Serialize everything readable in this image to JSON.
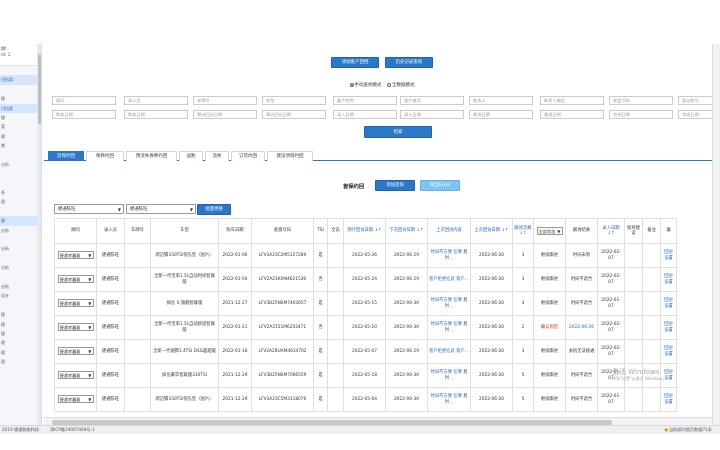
{
  "sidebar": {
    "head_line1": "期!",
    "head_line2": "nt: 1",
    "items": [
      {
        "label": "",
        "active": false
      },
      {
        "label": "归挡案",
        "active": true
      },
      {
        "label": "",
        "active": false
      },
      {
        "label": "理",
        "active": false
      },
      {
        "label": "归挡案",
        "active": true
      },
      {
        "label": "理",
        "active": false
      },
      {
        "label": "案",
        "active": false
      },
      {
        "label": "理",
        "active": false
      },
      {
        "label": "期",
        "active": false
      },
      {
        "label": "",
        "active": false
      },
      {
        "label": "分析",
        "active": false
      },
      {
        "label": "",
        "active": false
      },
      {
        "label": "",
        "active": false
      },
      {
        "label": "系",
        "active": false
      },
      {
        "label": "理",
        "active": false
      },
      {
        "label": "",
        "active": false
      },
      {
        "label": "量",
        "active": true
      },
      {
        "label": "分析",
        "active": false
      },
      {
        "label": "",
        "active": false
      },
      {
        "label": "分析",
        "active": false
      },
      {
        "label": "",
        "active": false
      },
      {
        "label": "分析",
        "active": false
      },
      {
        "label": "",
        "active": false
      },
      {
        "label": "分析",
        "active": false
      },
      {
        "label": "设计",
        "active": false
      },
      {
        "label": "",
        "active": false
      },
      {
        "label": "理",
        "active": false
      },
      {
        "label": "理",
        "active": false
      },
      {
        "label": "理",
        "active": false
      },
      {
        "label": "理",
        "active": false
      },
      {
        "label": "理",
        "active": false
      },
      {
        "label": "理",
        "active": false
      }
    ]
  },
  "top_buttons": {
    "add_customer": "添加客户回档",
    "history": "历史记录查询"
  },
  "radios": {
    "option1": "手动查找模式",
    "option2": "全数据模式"
  },
  "filters": [
    "顾问",
    "录入员",
    "车牌号",
    "车型",
    "客户名称",
    "客户电话",
    "联系人",
    "联系人电话",
    "底盘号码",
    "发动机号",
    "购车日期",
    "购车日期",
    "预计回访日期",
    "预计回访日期",
    "录入日期",
    "录入日期",
    "跟进日期",
    "跟进日期",
    "完成日期",
    "完成日期"
  ],
  "query_button": "检索",
  "tabs": [
    "首保约回",
    "保养约回",
    "预流失保养约回",
    "战败",
    "流失",
    "订货约回",
    "建议项目约回"
  ],
  "list": {
    "title": "首保约回",
    "add_button": "添加首保",
    "export_button": "导出Excel"
  },
  "batch": {
    "select1": "捷通陈旺",
    "select2": "捷通陈旺",
    "button": "批量更换"
  },
  "table": {
    "headers": [
      "顾问",
      "录入员",
      "车牌号",
      "车型",
      "购车日期",
      "底盘号码",
      "TSI",
      "全员",
      "预计回访日期 ↓↑",
      "下次回访日期 ↓↑",
      "上次回访内容",
      "上次回访日期 ↓↑",
      "跟进次数 ↓↑",
      "全部状态",
      "跟进结果",
      "录入日期 ↓↑",
      "指导建议",
      "备注",
      "操"
    ],
    "status_filter": "全部状态",
    "rows": [
      {
        "advisor": "捷通李鑫磊",
        "entry": "捷通陈旺",
        "plate": "",
        "model": "新迈腾330TSI领先型（国六）",
        "buy_date": "2022-01-06",
        "vin": "LFV3A23C2M5127289",
        "tsi": "是",
        "all": "",
        "expect": "2022-05-26",
        "next": "2022-06-29",
        "last_content": "时间不方便 在哪 看时...",
        "last_date": "2022-06-20",
        "count": "3",
        "status": "继续跟进",
        "result": "时间未到",
        "entry_date": "2022-02-07",
        "advice": "",
        "note": "",
        "op": "回访 设置",
        "red": false
      },
      {
        "advisor": "捷通李鑫磊",
        "entry": "捷通陈旺",
        "plate": "",
        "model": "全新一代宝来1.5L自动时尚智联版",
        "buy_date": "2022-01-04",
        "vin": "LFV2A21K0M4621526",
        "tsi": "否",
        "all": "",
        "expect": "2022-05-24",
        "next": "2022-06-29",
        "last_content": "客户拒绝在此 客户...",
        "last_date": "2022-06-20",
        "count": "3",
        "status": "继续跟进",
        "result": "时间不适合",
        "entry_date": "2022-02-07",
        "advice": "",
        "note": "",
        "op": "回访 设置",
        "red": false
      },
      {
        "advisor": "捷通李鑫磊",
        "entry": "捷通陈旺",
        "plate": "",
        "model": "探岳 X 旗舰智联版",
        "buy_date": "2021-12-27",
        "vin": "LFV3B25N0M7403657",
        "tsi": "是",
        "all": "",
        "expect": "2022-05-15",
        "next": "2022-06-30",
        "last_content": "时间不方便 在哪 看时...",
        "last_date": "2022-06-20",
        "count": "4",
        "status": "继续跟进",
        "result": "时间不适合",
        "entry_date": "2022-01-07",
        "advice": "",
        "note": "",
        "op": "回访 设置",
        "red": false
      },
      {
        "advisor": "捷通李鑫磊",
        "entry": "捷通陈旺",
        "plate": "",
        "model": "全新一代宝来1.5L自动舒适智联版",
        "buy_date": "2022-01-21",
        "vin": "LFV2A2151M6203471",
        "tsi": "否",
        "all": "",
        "expect": "2022-05-10",
        "next": "2022-06-30",
        "last_content": "时间不方便 在哪 看时...",
        "last_date": "2022-06-20",
        "count": "2",
        "status": "确认到店",
        "result": "2022-06-26",
        "entry_date": "2022-02-07",
        "advice": "",
        "note": "",
        "op": "回访 设置",
        "red": true
      },
      {
        "advisor": "捷通李鑫磊",
        "entry": "捷通陈旺",
        "plate": "",
        "model": "全新一代速腾1.4TSI DSG超越版",
        "buy_date": "2022-01-18",
        "vin": "LFV2A2BUXM4634702",
        "tsi": "是",
        "all": "",
        "expect": "2022-05-07",
        "next": "2022-06-29",
        "last_content": "客户拒绝在此 客户...",
        "last_date": "2022-06-20",
        "count": "3",
        "status": "继续跟进",
        "result": "关机无法接通",
        "entry_date": "2022-02-07",
        "advice": "",
        "note": "",
        "op": "回访 设置",
        "red": false
      },
      {
        "advisor": "捷通李鑫磊",
        "entry": "捷通陈旺",
        "plate": "",
        "model": "探岳豪华智联版330TSI",
        "buy_date": "2021-12-29",
        "vin": "LFV3B25N0M7066559",
        "tsi": "是",
        "all": "",
        "expect": "2022-05-18",
        "next": "2022-06-30",
        "last_content": "时间不方便 在哪 看时...",
        "last_date": "2022-06-20",
        "count": "5",
        "status": "继续跟进",
        "result": "时间不适合",
        "entry_date": "2022-01-07",
        "advice": "",
        "note": "",
        "op": "回访 设置",
        "red": false
      },
      {
        "advisor": "捷通李鑫磊",
        "entry": "捷通陈旺",
        "plate": "",
        "model": "新迈腾330TSI领先型（国六）",
        "buy_date": "2021-12-29",
        "vin": "LFV3A23C5M3118076",
        "tsi": "是",
        "all": "",
        "expect": "2022-05-04",
        "next": "2022-06-30",
        "last_content": "时间不方便 在哪 看时...",
        "last_date": "2022-06-20",
        "count": "5",
        "status": "继续跟进",
        "result": "时间不适合",
        "entry_date": "2022-01-07",
        "advice": "",
        "note": "",
        "op": "回访 设置",
        "red": false
      }
    ]
  },
  "watermark": {
    "line1": "激活 Windows",
    "line2": "转到\"设置\"以激活 Windows。"
  },
  "statusbar": {
    "left": "2019 捷通智能科技",
    "middle": "津ICP备19007469号-1",
    "right": "当前顾问首页数据71条"
  },
  "colors": {
    "primary": "#2b78c9",
    "light_button": "#7fc4ee",
    "link": "#2b62c2",
    "alert": "#d02020",
    "active_nav": "#d6e6fa"
  }
}
